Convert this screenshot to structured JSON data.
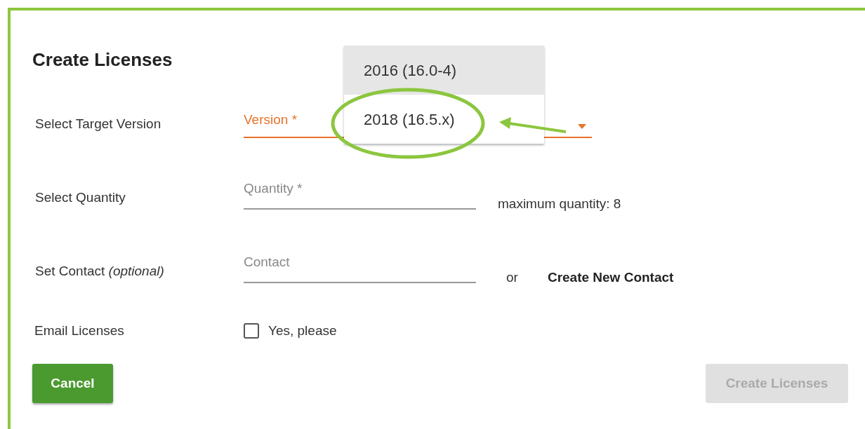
{
  "dialog": {
    "title": "Create Licenses",
    "version_row": {
      "label": "Select Target Version",
      "field": {
        "placeholder": "Version *",
        "focused": true
      },
      "menu": [
        {
          "label": "2016 (16.0-4)",
          "highlighted": true
        },
        {
          "label": "2018 (16.5.x)",
          "highlighted": false
        }
      ]
    },
    "quantity_row": {
      "label": "Select Quantity",
      "field": {
        "placeholder": "Quantity *"
      },
      "hint": "maximum quantity: 8"
    },
    "contact_row": {
      "label": "Set Contact *(optional)*",
      "field": {
        "placeholder": "Contact"
      },
      "separator": "or",
      "link": "Create New Contact"
    },
    "email_row": {
      "label": "Email Licenses",
      "checkbox": {
        "label": "Yes, please",
        "checked": false
      }
    },
    "buttons": [
      {
        "kind": "cancel",
        "label": "Cancel",
        "disabled": false
      },
      {
        "kind": "submit",
        "label": "Create Licenses",
        "disabled": true
      }
    ]
  }
}
